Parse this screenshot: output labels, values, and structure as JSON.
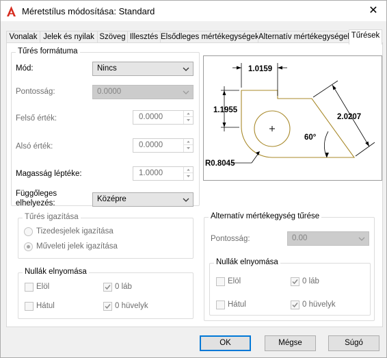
{
  "window": {
    "title": "Méretstílus módosítása: Standard",
    "close_glyph": "✕"
  },
  "tabs": [
    {
      "label": "Vonalak"
    },
    {
      "label": "Jelek és nyilak"
    },
    {
      "label": "Szöveg"
    },
    {
      "label": "Illesztés"
    },
    {
      "label": "Elsődleges mértékegységek"
    },
    {
      "label": "Alternatív mértékegységek"
    },
    {
      "label": "Tűrések",
      "active": true
    }
  ],
  "tolerance_format": {
    "title": "Tűrés formátuma",
    "method_label": "Mód:",
    "method_value": "Nincs",
    "precision_label": "Pontosság:",
    "precision_value": "0.0000",
    "upper_label": "Felső érték:",
    "upper_value": "0.0000",
    "lower_label": "Alsó érték:",
    "lower_value": "0.0000",
    "height_label": "Magasság léptéke:",
    "height_value": "1.0000",
    "vpos_label_line1": "Függőleges",
    "vpos_label_line2": "elhelyezés:",
    "vpos_value": "Középre"
  },
  "tolerance_alignment": {
    "title": "Tűrés igazítása",
    "opt_decimal": "Tizedesjelek igazítása",
    "opt_operational": "Műveleti jelek igazítása",
    "selected": "opt_operational"
  },
  "zero_suppression_left": {
    "title": "Nullák elnyomása",
    "leading": "Elöl",
    "trailing": "Hátul",
    "feet": "0 láb",
    "inches": "0 hüvelyk",
    "feet_checked": true,
    "inches_checked": true,
    "leading_checked": false,
    "trailing_checked": false
  },
  "alt_unit_tolerance": {
    "title": "Alternatív mértékegység tűrése",
    "precision_label": "Pontosság:",
    "precision_value": "0.00"
  },
  "zero_suppression_right": {
    "title": "Nullák elnyomása",
    "leading": "Elöl",
    "trailing": "Hátul",
    "feet": "0 láb",
    "inches": "0 hüvelyk",
    "feet_checked": true,
    "inches_checked": true,
    "leading_checked": false,
    "trailing_checked": false
  },
  "preview": {
    "dim_top": "1.0159",
    "dim_left": "1.1955",
    "dim_right": "2.0207",
    "dim_angle": "60°",
    "dim_radius": "R0.8045",
    "geometry_color": "#a8892a"
  },
  "buttons": {
    "ok": "OK",
    "cancel": "Mégse",
    "help": "Súgó"
  }
}
